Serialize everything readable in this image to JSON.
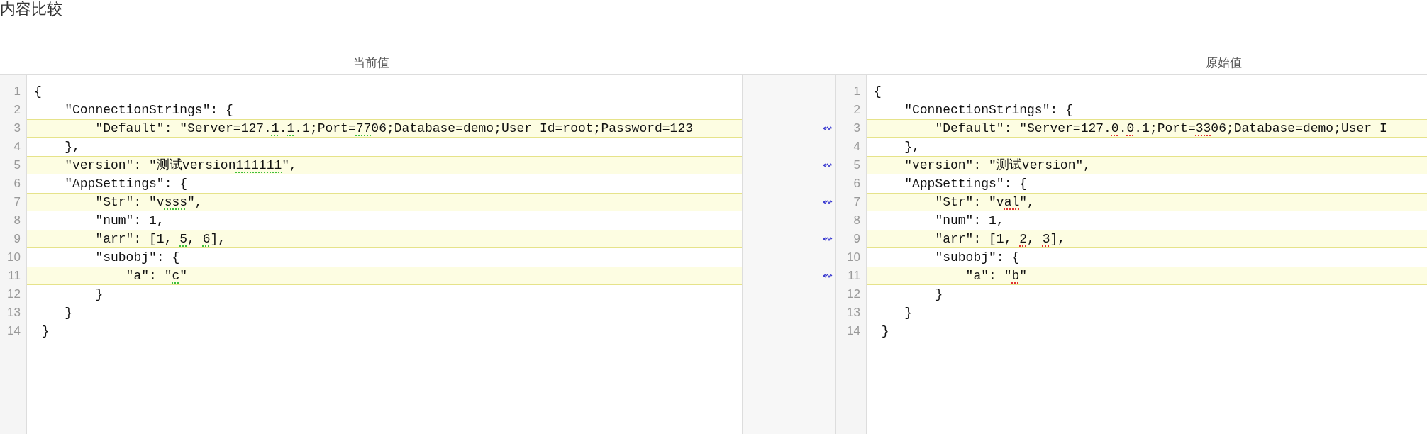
{
  "title": "内容比较",
  "panes": [
    {
      "kind": "current",
      "header": "当前值",
      "lines": [
        {
          "number": "1",
          "changed": false,
          "segments": [
            {
              "text": "{",
              "diff": false
            }
          ]
        },
        {
          "number": "2",
          "changed": false,
          "segments": [
            {
              "text": "    \"ConnectionStrings\": {",
              "diff": false
            }
          ]
        },
        {
          "number": "3",
          "changed": true,
          "segments": [
            {
              "text": "        \"Default\": \"Server=127.",
              "diff": false
            },
            {
              "text": "1",
              "diff": true
            },
            {
              "text": ".",
              "diff": false
            },
            {
              "text": "1",
              "diff": true
            },
            {
              "text": ".1;Port=",
              "diff": false
            },
            {
              "text": "77",
              "diff": true
            },
            {
              "text": "06;Database=demo;User Id=root;Password=123",
              "diff": false
            }
          ]
        },
        {
          "number": "4",
          "changed": false,
          "segments": [
            {
              "text": "    },",
              "diff": false
            }
          ]
        },
        {
          "number": "5",
          "changed": true,
          "segments": [
            {
              "text": "    \"version\": \"测试version",
              "diff": false
            },
            {
              "text": "111111",
              "diff": true
            },
            {
              "text": "\",",
              "diff": false
            }
          ]
        },
        {
          "number": "6",
          "changed": false,
          "segments": [
            {
              "text": "    \"AppSettings\": {",
              "diff": false
            }
          ]
        },
        {
          "number": "7",
          "changed": true,
          "segments": [
            {
              "text": "        \"Str\": \"v",
              "diff": false
            },
            {
              "text": "sss",
              "diff": true
            },
            {
              "text": "\",",
              "diff": false
            }
          ]
        },
        {
          "number": "8",
          "changed": false,
          "segments": [
            {
              "text": "        \"num\": 1,",
              "diff": false
            }
          ]
        },
        {
          "number": "9",
          "changed": true,
          "segments": [
            {
              "text": "        \"arr\": [1, ",
              "diff": false
            },
            {
              "text": "5",
              "diff": true
            },
            {
              "text": ", ",
              "diff": false
            },
            {
              "text": "6",
              "diff": true
            },
            {
              "text": "],",
              "diff": false
            }
          ]
        },
        {
          "number": "10",
          "changed": false,
          "segments": [
            {
              "text": "        \"subobj\": {",
              "diff": false
            }
          ]
        },
        {
          "number": "11",
          "changed": true,
          "segments": [
            {
              "text": "            \"a\": \"",
              "diff": false
            },
            {
              "text": "c",
              "diff": true
            },
            {
              "text": "\"",
              "diff": false
            }
          ]
        },
        {
          "number": "12",
          "changed": false,
          "segments": [
            {
              "text": "        }",
              "diff": false
            }
          ]
        },
        {
          "number": "13",
          "changed": false,
          "segments": [
            {
              "text": "    }",
              "diff": false
            }
          ]
        },
        {
          "number": "14",
          "changed": false,
          "segments": [
            {
              "text": " }",
              "diff": false
            }
          ]
        }
      ]
    },
    {
      "kind": "original",
      "header": "原始值",
      "lines": [
        {
          "number": "1",
          "changed": false,
          "segments": [
            {
              "text": "{",
              "diff": false
            }
          ]
        },
        {
          "number": "2",
          "changed": false,
          "segments": [
            {
              "text": "    \"ConnectionStrings\": {",
              "diff": false
            }
          ]
        },
        {
          "number": "3",
          "changed": true,
          "segments": [
            {
              "text": "        \"Default\": \"Server=127.",
              "diff": false
            },
            {
              "text": "0",
              "diff": true
            },
            {
              "text": ".",
              "diff": false
            },
            {
              "text": "0",
              "diff": true
            },
            {
              "text": ".1;Port=",
              "diff": false
            },
            {
              "text": "33",
              "diff": true
            },
            {
              "text": "06;Database=demo;User I",
              "diff": false
            }
          ]
        },
        {
          "number": "4",
          "changed": false,
          "segments": [
            {
              "text": "    },",
              "diff": false
            }
          ]
        },
        {
          "number": "5",
          "changed": true,
          "segments": [
            {
              "text": "    \"version\": \"测试version\",",
              "diff": false
            }
          ]
        },
        {
          "number": "6",
          "changed": false,
          "segments": [
            {
              "text": "    \"AppSettings\": {",
              "diff": false
            }
          ]
        },
        {
          "number": "7",
          "changed": true,
          "segments": [
            {
              "text": "        \"Str\": \"v",
              "diff": false
            },
            {
              "text": "al",
              "diff": true
            },
            {
              "text": "\",",
              "diff": false
            }
          ]
        },
        {
          "number": "8",
          "changed": false,
          "segments": [
            {
              "text": "        \"num\": 1,",
              "diff": false
            }
          ]
        },
        {
          "number": "9",
          "changed": true,
          "segments": [
            {
              "text": "        \"arr\": [1, ",
              "diff": false
            },
            {
              "text": "2",
              "diff": true
            },
            {
              "text": ", ",
              "diff": false
            },
            {
              "text": "3",
              "diff": true
            },
            {
              "text": "],",
              "diff": false
            }
          ]
        },
        {
          "number": "10",
          "changed": false,
          "segments": [
            {
              "text": "        \"subobj\": {",
              "diff": false
            }
          ]
        },
        {
          "number": "11",
          "changed": true,
          "segments": [
            {
              "text": "            \"a\": \"",
              "diff": false
            },
            {
              "text": "b",
              "diff": true
            },
            {
              "text": "\"",
              "diff": false
            }
          ]
        },
        {
          "number": "12",
          "changed": false,
          "segments": [
            {
              "text": "        }",
              "diff": false
            }
          ]
        },
        {
          "number": "13",
          "changed": false,
          "segments": [
            {
              "text": "    }",
              "diff": false
            }
          ]
        },
        {
          "number": "14",
          "changed": false,
          "segments": [
            {
              "text": " }",
              "diff": false
            }
          ]
        }
      ]
    }
  ]
}
